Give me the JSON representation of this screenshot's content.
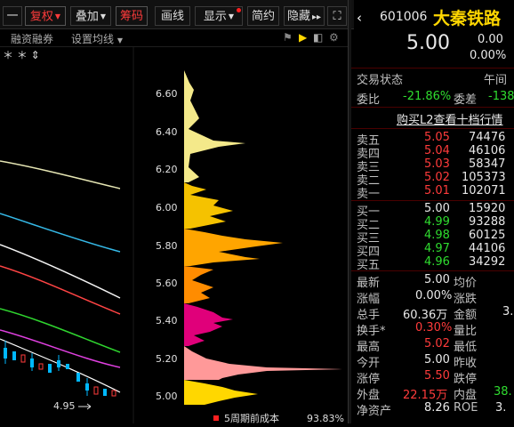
{
  "toolbar": {
    "dash": "一",
    "fuquan": "复权",
    "diejia": "叠加",
    "chouma": "筹码",
    "huaxian": "画线",
    "xianshi": "显示",
    "jianyue": "简约",
    "yincang": "隐藏",
    "more": "▸▸",
    "fullscreen": "⛶"
  },
  "subbar": {
    "rzrq": "融资融券",
    "junxian": "设置均线",
    "stars": "＊ ＊ ⇕"
  },
  "chart": {
    "low_label": "4.95",
    "period_label": "5周期前成本",
    "pct_label": "93.83%",
    "prices": [
      "6.60",
      "6.40",
      "6.20",
      "6.00",
      "5.80",
      "5.60",
      "5.40",
      "5.20",
      "5.00"
    ]
  },
  "quote": {
    "code": "601006",
    "name": "大秦铁路",
    "price": "5.00",
    "change": "0.00",
    "change_pct": "0.00%",
    "status_label": "交易状态",
    "status_value": "午间",
    "weibi_label": "委比",
    "weibi_value": "-21.86%",
    "weicha_label": "委差",
    "weicha_value": "-138",
    "l2_link": "购买L2查看十档行情",
    "asks": [
      {
        "label": "卖五",
        "price": "5.05",
        "vol": "74476"
      },
      {
        "label": "卖四",
        "price": "5.04",
        "vol": "46106"
      },
      {
        "label": "卖三",
        "price": "5.03",
        "vol": "58347"
      },
      {
        "label": "卖二",
        "price": "5.02",
        "vol": "105373"
      },
      {
        "label": "卖一",
        "price": "5.01",
        "vol": "102071"
      }
    ],
    "bids": [
      {
        "label": "买一",
        "price": "5.00",
        "vol": "15920"
      },
      {
        "label": "买二",
        "price": "4.99",
        "vol": "93288"
      },
      {
        "label": "买三",
        "price": "4.98",
        "vol": "60125"
      },
      {
        "label": "买四",
        "price": "4.97",
        "vol": "44106"
      },
      {
        "label": "买五",
        "price": "4.96",
        "vol": "34292"
      }
    ],
    "stats": [
      {
        "l": "最新",
        "v": "5.00",
        "l2": "均价",
        "v2": ""
      },
      {
        "l": "涨幅",
        "v": "0.00%",
        "l2": "涨跌",
        "v2": ""
      },
      {
        "l": "总手",
        "v": "60.36万",
        "l2": "金额",
        "v2": "3."
      },
      {
        "l": "换手*",
        "v": "0.30%",
        "l2": "量比",
        "v2": ""
      },
      {
        "l": "最高",
        "v": "5.02",
        "l2": "最低",
        "v2": ""
      },
      {
        "l": "今开",
        "v": "5.00",
        "l2": "昨收",
        "v2": ""
      },
      {
        "l": "涨停",
        "v": "5.50",
        "l2": "跌停",
        "v2": ""
      },
      {
        "l": "外盘",
        "v": "22.15万",
        "l2": "内盘",
        "v2": "38."
      },
      {
        "l": "净资产",
        "v": "8.26",
        "l2": "ROE",
        "v2": "3."
      }
    ]
  },
  "colors": {
    "up": "#ff3b3b",
    "down": "#2fdc2f",
    "accent": "#ffd700",
    "bg": "#000000"
  }
}
